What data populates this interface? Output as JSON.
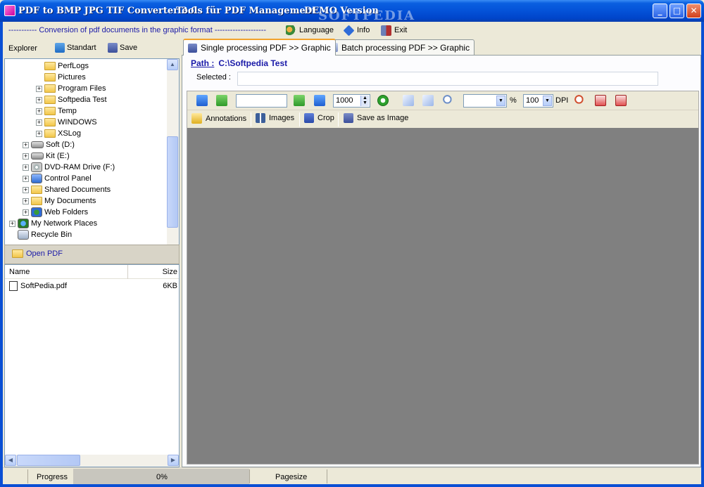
{
  "window": {
    "title_parts": [
      "PDF to BMP JPG TIF Converter 2.0",
      "Tools für PDF Management",
      "DEMO Version"
    ],
    "watermark": "SOFTPEDIA",
    "minimize": "_",
    "maximize": "□",
    "close": "✕"
  },
  "menu": {
    "conversion_text": "----------- Conversion of pdf documents in the graphic format --------------------",
    "language": "Language",
    "info": "Info",
    "exit": "Exit"
  },
  "explorer": {
    "label": "Explorer",
    "standart": "Standart",
    "save": "Save",
    "tree": [
      {
        "label": "PerfLogs",
        "indent": 3,
        "expander": "",
        "icon": "folder"
      },
      {
        "label": "Pictures",
        "indent": 3,
        "expander": "",
        "icon": "folder"
      },
      {
        "label": "Program Files",
        "indent": 3,
        "expander": "+",
        "icon": "folder"
      },
      {
        "label": "Softpedia Test",
        "indent": 3,
        "expander": "+",
        "icon": "folder"
      },
      {
        "label": "Temp",
        "indent": 3,
        "expander": "+",
        "icon": "folder"
      },
      {
        "label": "WINDOWS",
        "indent": 3,
        "expander": "+",
        "icon": "folder"
      },
      {
        "label": "XSLog",
        "indent": 3,
        "expander": "+",
        "icon": "folder"
      },
      {
        "label": "Soft (D:)",
        "indent": 2,
        "expander": "+",
        "icon": "drive"
      },
      {
        "label": "Kit (E:)",
        "indent": 2,
        "expander": "+",
        "icon": "drive"
      },
      {
        "label": "DVD-RAM Drive (F:)",
        "indent": 2,
        "expander": "+",
        "icon": "dvd"
      },
      {
        "label": "Control Panel",
        "indent": 2,
        "expander": "+",
        "icon": "control"
      },
      {
        "label": "Shared Documents",
        "indent": 2,
        "expander": "+",
        "icon": "folder"
      },
      {
        "label": "My Documents",
        "indent": 2,
        "expander": "+",
        "icon": "folder"
      },
      {
        "label": "Web Folders",
        "indent": 2,
        "expander": "+",
        "icon": "web"
      },
      {
        "label": "My Network Places",
        "indent": 1,
        "expander": "+",
        "icon": "network"
      },
      {
        "label": "Recycle Bin",
        "indent": 1,
        "expander": "",
        "icon": "recycle"
      }
    ]
  },
  "open_pdf": {
    "label": "Open PDF",
    "columns": [
      "Name",
      "Size"
    ],
    "files": [
      {
        "name": "SoftPedia.pdf",
        "size": "6KB"
      }
    ]
  },
  "tabs": [
    {
      "label": "Single processing PDF >> Graphic",
      "active": true
    },
    {
      "label": "Batch processing PDF >> Graphic",
      "active": false
    }
  ],
  "single": {
    "path_label": "Path :",
    "path_value": "C:\\Softpedia Test",
    "selected_label": "Selected :",
    "selected_value": ""
  },
  "viewer": {
    "page_input": "",
    "zoom_value": "1000",
    "scale_value": "",
    "percent_label": "%",
    "dpi_value": "100",
    "dpi_label": "DPI",
    "annotations": "Annotations",
    "images": "Images",
    "crop": "Crop",
    "save_as_image": "Save as Image"
  },
  "status": {
    "progress_label": "Progress",
    "progress_value": "0%",
    "progress_fraction": 0,
    "pagesize_label": "Pagesize"
  }
}
